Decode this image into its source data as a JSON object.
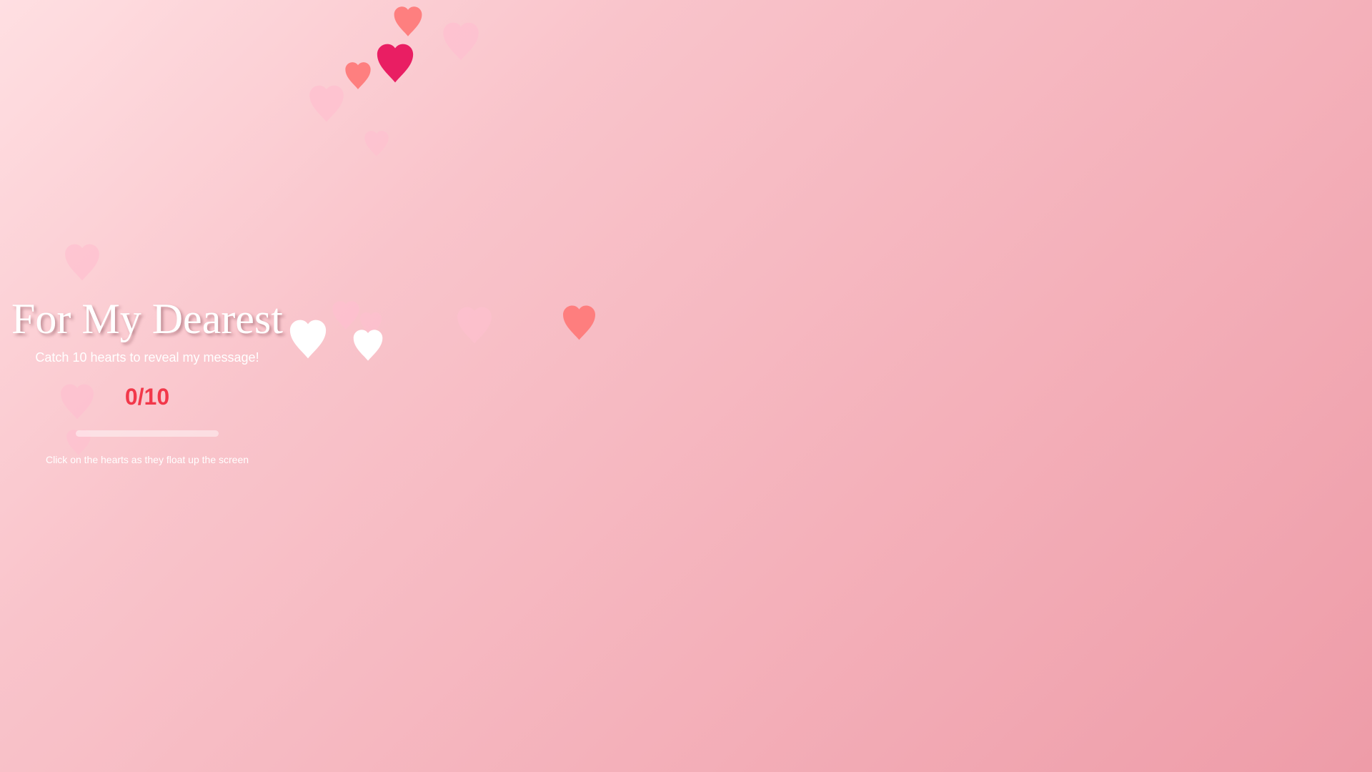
{
  "game": {
    "title": "For My Dearest",
    "instruction": "Catch 10 hearts to reveal my message!",
    "score_text": "0/10",
    "caught": 0,
    "target": 10,
    "progress_fraction": 0,
    "hint": "Click on the hearts as they float up the screen"
  },
  "colors": {
    "score": "#f2384a",
    "heart_light_pink": "#ffc0d0",
    "heart_coral": "#ff7b7b",
    "heart_crimson": "#e91e63",
    "heart_white": "#ffffff"
  },
  "hearts": [
    {
      "color": "coral"
    },
    {
      "color": "light-pink"
    },
    {
      "color": "crimson"
    },
    {
      "color": "coral"
    },
    {
      "color": "light-pink"
    },
    {
      "color": "light-pink"
    },
    {
      "color": "light-pink"
    },
    {
      "color": "light-pink"
    },
    {
      "color": "light-pink"
    },
    {
      "color": "white"
    },
    {
      "color": "white"
    },
    {
      "color": "light-pink"
    },
    {
      "color": "coral"
    },
    {
      "color": "light-pink"
    },
    {
      "color": "light-pink"
    }
  ]
}
